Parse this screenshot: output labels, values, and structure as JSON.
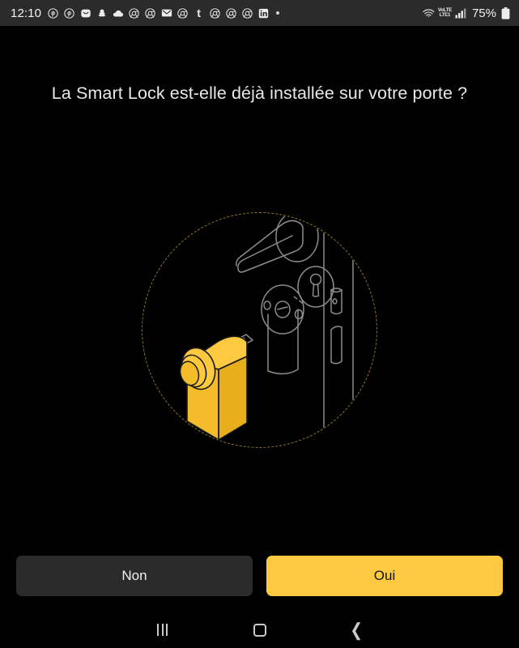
{
  "statusbar": {
    "clock": "12:10",
    "battery_percent": "75%",
    "network_label_top": "VoLTE",
    "network_label_bottom": "LTE1",
    "icons": [
      {
        "name": "pinterest-icon",
        "glyph": "P"
      },
      {
        "name": "pinterest-icon",
        "glyph": "P"
      },
      {
        "name": "message-icon",
        "glyph": "M"
      },
      {
        "name": "snapchat-icon",
        "glyph": "S"
      },
      {
        "name": "cloud-icon",
        "glyph": "C"
      },
      {
        "name": "chrome-icon",
        "glyph": "G"
      },
      {
        "name": "chrome-icon",
        "glyph": "G"
      },
      {
        "name": "mail-icon",
        "glyph": "E"
      },
      {
        "name": "chrome-icon",
        "glyph": "G"
      },
      {
        "name": "tumblr-icon",
        "glyph": "t"
      },
      {
        "name": "chrome-icon",
        "glyph": "G"
      },
      {
        "name": "chrome-icon",
        "glyph": "G"
      },
      {
        "name": "chrome-icon",
        "glyph": "G"
      },
      {
        "name": "linkedin-icon",
        "glyph": "in"
      },
      {
        "name": "overflow-dot-icon",
        "glyph": "."
      }
    ],
    "wifi_icon": "wifi-icon",
    "signal_icon": "cellular-signal-icon",
    "battery_icon": "battery-icon"
  },
  "main": {
    "question": "La Smart Lock est-elle déjà installée sur votre porte ?",
    "illustration": {
      "name": "smart-lock-on-door-illustration",
      "accent_color": "#fcc941",
      "outline_color": "#8c8c8c",
      "dashed_circle_color": "#8d762f",
      "parts": [
        "door-edge",
        "door-handle",
        "latch-bolt",
        "strike-plate",
        "lock-cylinder",
        "keyhole",
        "key",
        "smart-lock-device"
      ]
    }
  },
  "actions": {
    "no_label": "Non",
    "yes_label": "Oui",
    "no_color": "#2b2b2b",
    "yes_color": "#fcc941"
  },
  "navbar": {
    "recents_label": "Recents",
    "home_label": "Home",
    "back_label": "Back"
  }
}
